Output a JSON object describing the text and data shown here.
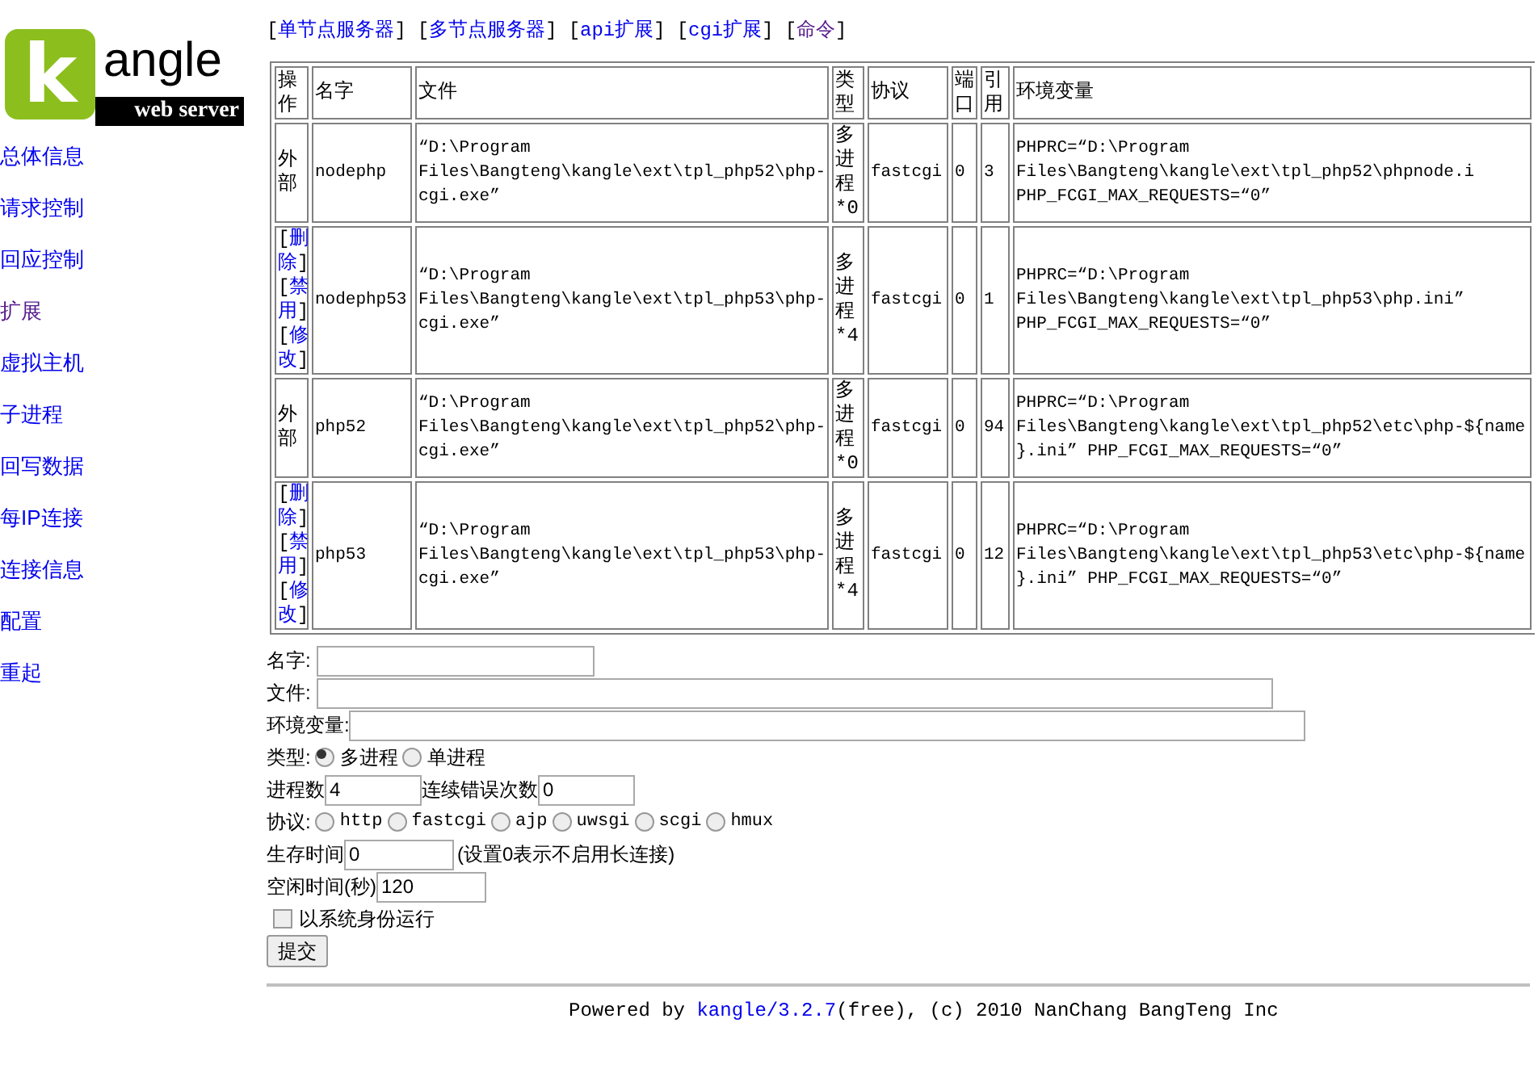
{
  "logo": {
    "letter": "k",
    "word": "angle",
    "tagline": "web server"
  },
  "sidebar": {
    "items": [
      {
        "label": "总体信息",
        "visited": false
      },
      {
        "label": "请求控制",
        "visited": false
      },
      {
        "label": "回应控制",
        "visited": false
      },
      {
        "label": "扩展",
        "visited": true
      },
      {
        "label": "虚拟主机",
        "visited": false
      },
      {
        "label": "子进程",
        "visited": false
      },
      {
        "label": "回写数据",
        "visited": false
      },
      {
        "label": "每IP连接",
        "visited": false
      },
      {
        "label": "连接信息",
        "visited": false
      },
      {
        "label": "配置",
        "visited": false
      },
      {
        "label": "重起",
        "visited": false
      }
    ]
  },
  "top_nav": [
    {
      "label": "[单节点服务器]",
      "visited": false
    },
    {
      "label": "[多节点服务器]",
      "visited": false
    },
    {
      "label": "[api扩展]",
      "visited": false
    },
    {
      "label": "[cgi扩展]",
      "visited": false
    },
    {
      "label": "[命令]",
      "visited": true
    }
  ],
  "table": {
    "columns": [
      "操作",
      "名字",
      "文件",
      "类型",
      "协议",
      "端口",
      "引用",
      "环境变量"
    ],
    "rows": [
      {
        "kind": "text",
        "operation": "外部",
        "name": "nodephp",
        "file": "“D:\\Program Files\\Bangteng\\kangle\\ext\\tpl_php52\\php-cgi.exe”",
        "type": "多进程*0",
        "protocol": "fastcgi",
        "port": "0",
        "refs": "3",
        "env": "PHPRC=“D:\\Program Files\\Bangteng\\kangle\\ext\\tpl_php52\\phpnode.i PHP_FCGI_MAX_REQUESTS=“0”"
      },
      {
        "kind": "links",
        "actions": [
          "[删除]",
          "[禁用]",
          "[修改]"
        ],
        "name": "nodephp53",
        "file": "“D:\\Program Files\\Bangteng\\kangle\\ext\\tpl_php53\\php-cgi.exe”",
        "type": "多进程*4",
        "protocol": "fastcgi",
        "port": "0",
        "refs": "1",
        "env": "PHPRC=“D:\\Program Files\\Bangteng\\kangle\\ext\\tpl_php53\\php.ini” PHP_FCGI_MAX_REQUESTS=“0”"
      },
      {
        "kind": "text",
        "operation": "外部",
        "name": "php52",
        "file": "“D:\\Program Files\\Bangteng\\kangle\\ext\\tpl_php52\\php-cgi.exe”",
        "type": "多进程*0",
        "protocol": "fastcgi",
        "port": "0",
        "refs": "94",
        "env": "PHPRC=“D:\\Program Files\\Bangteng\\kangle\\ext\\tpl_php52\\etc\\php-${name}.ini” PHP_FCGI_MAX_REQUESTS=“0”"
      },
      {
        "kind": "links",
        "actions": [
          "[删除]",
          "[禁用]",
          "[修改]"
        ],
        "name": "php53",
        "file": "“D:\\Program Files\\Bangteng\\kangle\\ext\\tpl_php53\\php-cgi.exe”",
        "type": "多进程*4",
        "protocol": "fastcgi",
        "port": "0",
        "refs": "12",
        "env": "PHPRC=“D:\\Program Files\\Bangteng\\kangle\\ext\\tpl_php53\\etc\\php-${name}.ini” PHP_FCGI_MAX_REQUESTS=“0”"
      }
    ]
  },
  "form": {
    "name_label": "名字:",
    "file_label": "文件:",
    "env_label": "环境变量:",
    "type_label": "类型:",
    "type_options": [
      {
        "label": "多进程",
        "selected": true
      },
      {
        "label": "单进程",
        "selected": false
      }
    ],
    "procs_label": "进程数",
    "procs_value": "4",
    "errors_label": "连续错误次数",
    "errors_value": "0",
    "protocol_label": "协议:",
    "protocol_options": [
      {
        "label": "http",
        "selected": false
      },
      {
        "label": "fastcgi",
        "selected": false
      },
      {
        "label": "ajp",
        "selected": false
      },
      {
        "label": "uwsgi",
        "selected": false
      },
      {
        "label": "scgi",
        "selected": false
      },
      {
        "label": "hmux",
        "selected": false
      }
    ],
    "lifetime_label": "生存时间",
    "lifetime_value": "0",
    "lifetime_hint": "(设置0表示不启用长连接)",
    "idle_label": "空闲时间(秒)",
    "idle_value": "120",
    "system_identity": {
      "label": "以系统身份运行",
      "checked": false
    },
    "submit": "提交"
  },
  "footer": {
    "prefix": "Powered by ",
    "link": "kangle/3.2.7",
    "suffix": "(free), (c) 2010 NanChang BangTeng Inc"
  }
}
